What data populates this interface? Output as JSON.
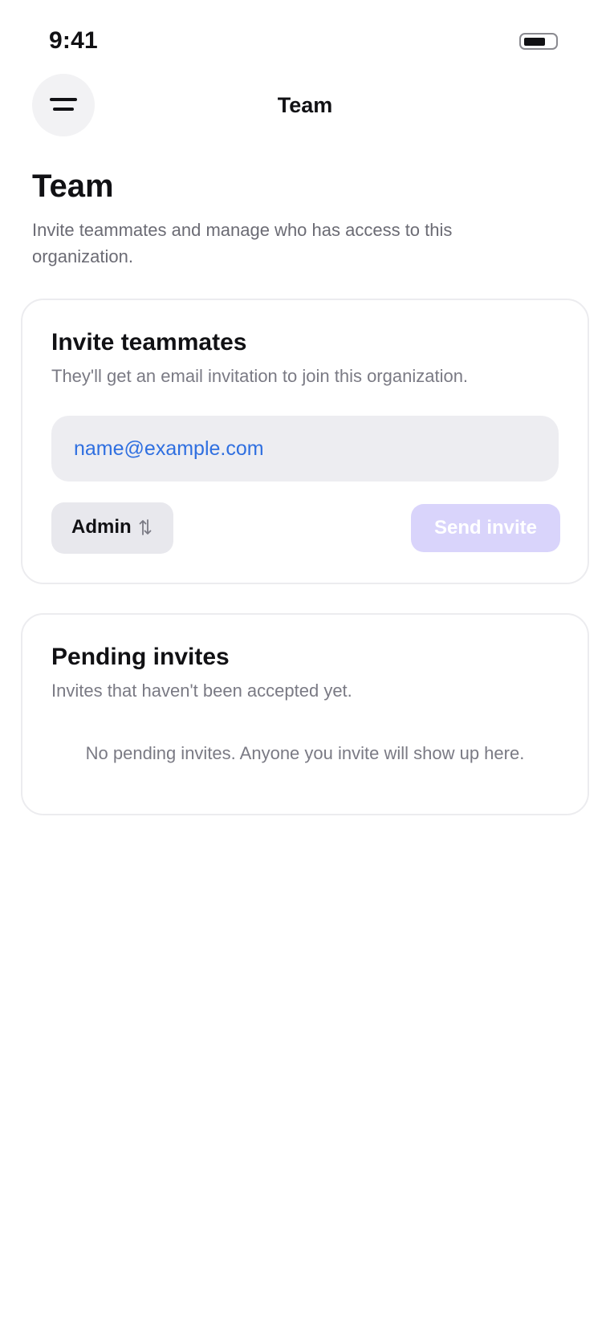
{
  "status_bar": {
    "time": "9:41"
  },
  "nav": {
    "title": "Team",
    "menu_icon": "menu-icon"
  },
  "page": {
    "title": "Team",
    "subtitle": "Invite teammates and manage who has access to this organization."
  },
  "invite_card": {
    "title": "Invite teammates",
    "description": "They'll get an email invitation to join this organization.",
    "email_placeholder": "name@example.com",
    "email_value": "",
    "role_selected": "Admin",
    "role_icon": "up-down-arrows-icon",
    "send_label": "Send invite",
    "send_disabled": true
  },
  "pending_card": {
    "title": "Pending invites",
    "description": "Invites that haven't been accepted yet.",
    "empty_message": "No pending invites. Anyone you invite will show up here."
  },
  "colors": {
    "accent_disabled": "#d9d4fb",
    "link_blue": "#2f6fe0",
    "input_bg": "#ededf1",
    "muted_text": "#7a7a84"
  }
}
